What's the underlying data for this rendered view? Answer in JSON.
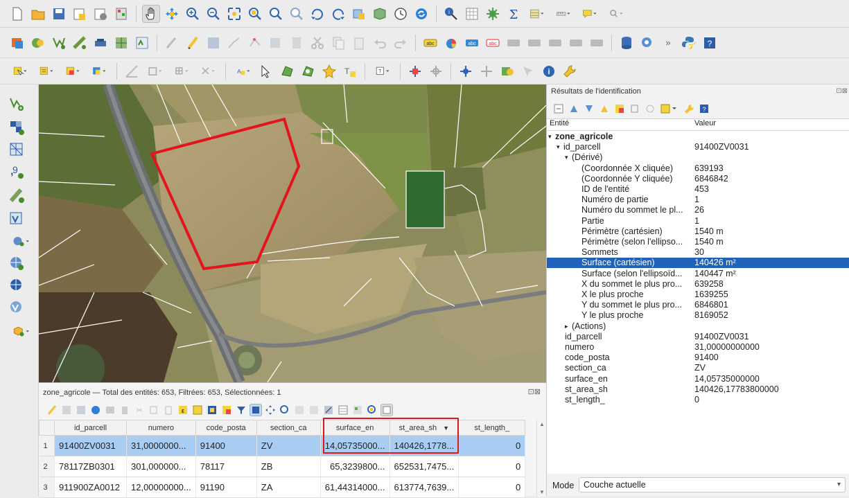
{
  "attribute_table": {
    "title": "zone_agricole — Total des entités: 653, Filtrées: 653, Sélectionnées: 1",
    "columns": [
      "id_parcell",
      "numero",
      "code_posta",
      "section_ca",
      "surface_en",
      "st_area_sh",
      "st_length_"
    ],
    "sort_indicator": "▼",
    "rows": [
      {
        "n": "1",
        "id_parcell": "91400ZV0031",
        "numero": "31,0000000...",
        "code_posta": "91400",
        "section_ca": "ZV",
        "surface_en": "14,05735000...",
        "st_area_sh": "140426,1778...",
        "st_length_": "0"
      },
      {
        "n": "2",
        "id_parcell": "78117ZB0301",
        "numero": "301,000000...",
        "code_posta": "78117",
        "section_ca": "ZB",
        "surface_en": "65,3239800...",
        "st_area_sh": "652531,7475...",
        "st_length_": "0"
      },
      {
        "n": "3",
        "id_parcell": "911900ZA0012",
        "numero": "12,00000000...",
        "code_posta": "91190",
        "section_ca": "ZA",
        "surface_en": "61,44314000...",
        "st_area_sh": "613774,7639...",
        "st_length_": "0"
      }
    ],
    "highlight_color": "#e0161e"
  },
  "identify": {
    "title": "Résultats de l'identification",
    "col_entity": "Entité",
    "col_value": "Valeur",
    "rows": [
      {
        "k": "zone_agricole",
        "v": "",
        "indent": 0,
        "arrow": "▾",
        "bold": true
      },
      {
        "k": "id_parcell",
        "v": "91400ZV0031",
        "indent": 1,
        "arrow": "▾"
      },
      {
        "k": "(Dérivé)",
        "v": "",
        "indent": 2,
        "arrow": "▾"
      },
      {
        "k": "(Coordonnée X cliquée)",
        "v": "639193",
        "indent": 3
      },
      {
        "k": "(Coordonnée Y cliquée)",
        "v": "6846842",
        "indent": 3
      },
      {
        "k": "ID de l'entité",
        "v": "453",
        "indent": 3
      },
      {
        "k": "Numéro de partie",
        "v": "1",
        "indent": 3
      },
      {
        "k": "Numéro du sommet le pl...",
        "v": "26",
        "indent": 3
      },
      {
        "k": "Partie",
        "v": "1",
        "indent": 3
      },
      {
        "k": "Périmètre (cartésien)",
        "v": "1540 m",
        "indent": 3
      },
      {
        "k": "Périmètre (selon l'ellipso...",
        "v": "1540 m",
        "indent": 3
      },
      {
        "k": "Sommets",
        "v": "30",
        "indent": 3
      },
      {
        "k": "Surface (cartésien)",
        "v": "140426 m²",
        "indent": 3,
        "selected": true
      },
      {
        "k": "Surface (selon l'ellipsoïd...",
        "v": "140447 m²",
        "indent": 3
      },
      {
        "k": "X du sommet le plus pro...",
        "v": "639258",
        "indent": 3
      },
      {
        "k": "X le plus proche",
        "v": "1639255",
        "indent": 3
      },
      {
        "k": "Y du sommet le plus pro...",
        "v": "6846801",
        "indent": 3
      },
      {
        "k": "Y le plus proche",
        "v": "8169052",
        "indent": 3
      },
      {
        "k": "(Actions)",
        "v": "",
        "indent": 2,
        "arrow": "▸"
      },
      {
        "k": "id_parcell",
        "v": "91400ZV0031",
        "indent": 2
      },
      {
        "k": "numero",
        "v": "31,00000000000",
        "indent": 2
      },
      {
        "k": "code_posta",
        "v": "91400",
        "indent": 2
      },
      {
        "k": "section_ca",
        "v": "ZV",
        "indent": 2
      },
      {
        "k": "surface_en",
        "v": "14,05735000000",
        "indent": 2
      },
      {
        "k": "st_area_sh",
        "v": "140426,17783800000",
        "indent": 2
      },
      {
        "k": "st_length_",
        "v": "0",
        "indent": 2
      }
    ],
    "mode_label": "Mode",
    "mode_value": "Couche actuelle"
  },
  "map": {
    "parcel_outline_color": "#e3141b",
    "parcel_layer": "zone_agricole"
  }
}
